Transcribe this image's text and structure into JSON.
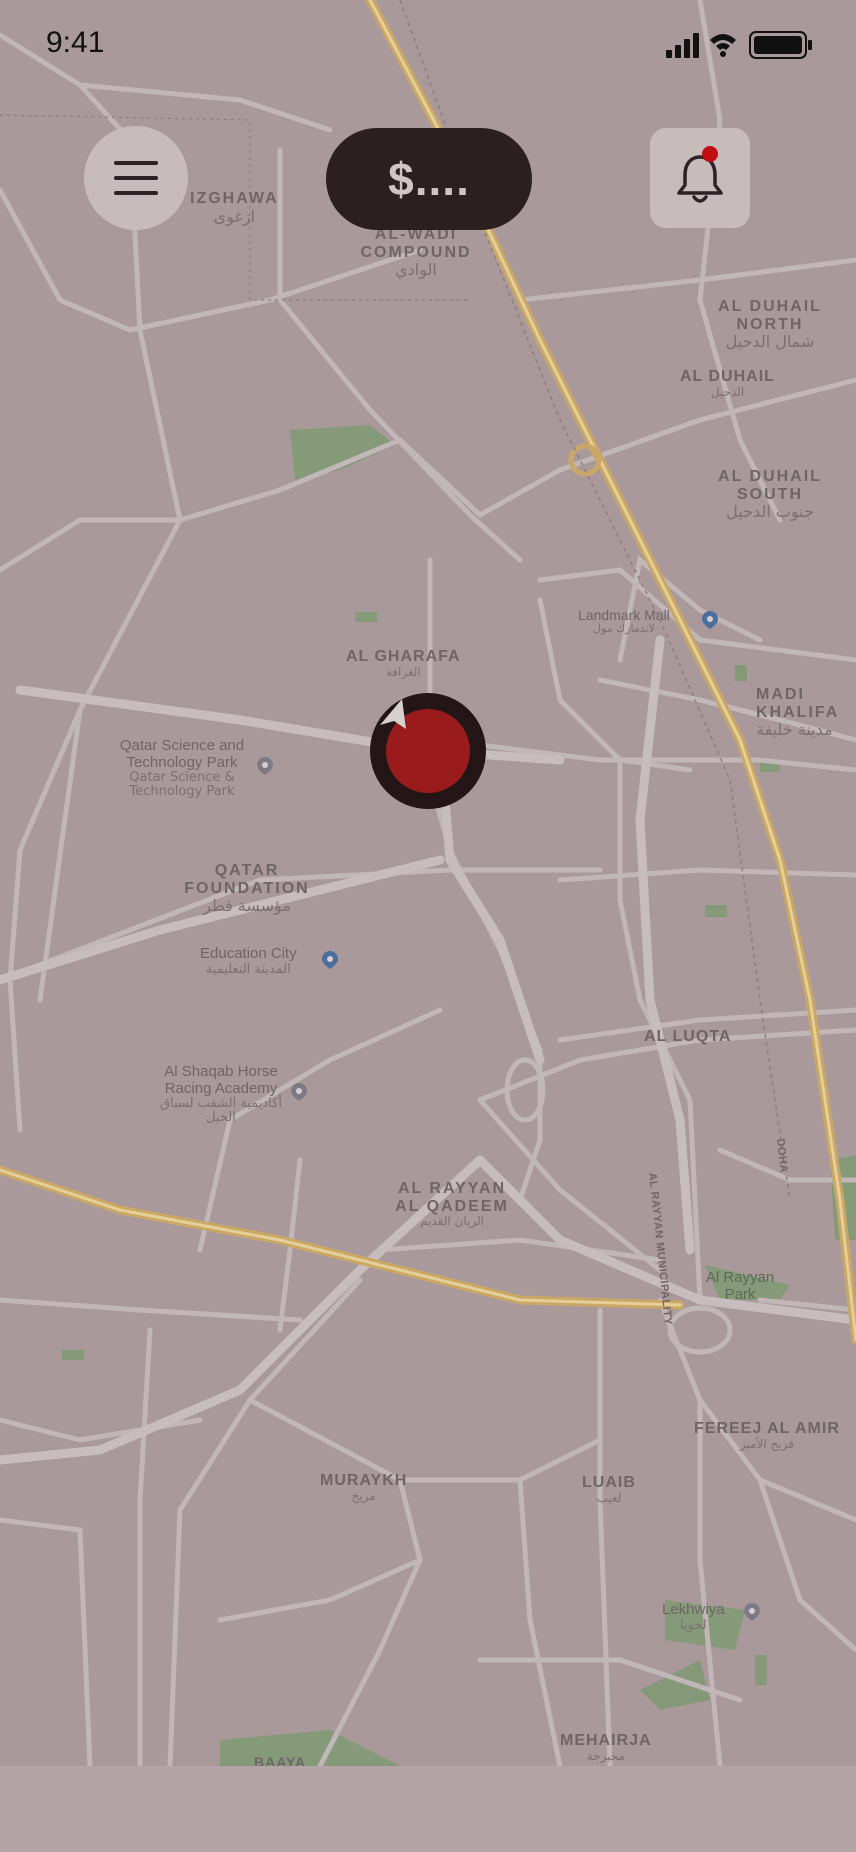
{
  "status_bar": {
    "time": "9:41"
  },
  "header": {
    "balance_label": "$...."
  },
  "icons": {
    "menu": "hamburger-menu-icon",
    "notifications": "bell-icon",
    "location": "navigation-arrow-icon"
  },
  "colors": {
    "pill_bg": "#2b1f20",
    "notification_dot": "#c00d14",
    "marker": "#9a1b1b",
    "map_bg": "#a9999b"
  },
  "map": {
    "areas": [
      {
        "en": "IZGHAWA",
        "ar": "ازغوى"
      },
      {
        "en": "AL-WADI COMPOUND",
        "ar": "الوادي"
      },
      {
        "en": "AL DUHAIL NORTH",
        "ar": "شمال الدحيل"
      },
      {
        "en": "AL DUHAIL",
        "ar": "الدحيل"
      },
      {
        "en": "AL DUHAIL SOUTH",
        "ar": "جنوب الدحيل"
      },
      {
        "en": "AL GHARAFA",
        "ar": "الغرافة"
      },
      {
        "en": "MADI KHALIFA",
        "ar": "مدينة خليفة"
      },
      {
        "en": "QATAR FOUNDATION",
        "ar": "مؤسسة قطر"
      },
      {
        "en": "AL LUQTA",
        "ar": ""
      },
      {
        "en": "AL RAYYAN AL QADEEM",
        "ar": "الريان القديم"
      },
      {
        "en": "FEREEJ AL AMIR",
        "ar": "فريج الأمير"
      },
      {
        "en": "MURAYKH",
        "ar": "مريخ"
      },
      {
        "en": "LUAIB",
        "ar": "لعيب"
      },
      {
        "en": "MEHAIRJA",
        "ar": "محيرجة"
      },
      {
        "en": "BAAYA",
        "ar": ""
      },
      {
        "en": "AL RAYYAN MUNICIPALITY",
        "ar": ""
      },
      {
        "en": "DOHA",
        "ar": ""
      }
    ],
    "pois": [
      {
        "en": "Landmark Mall",
        "ar": "لاندمارك مول"
      },
      {
        "en": "Qatar Science and Technology Park",
        "ar": "Qatar Science & Technology Park"
      },
      {
        "en": "Education City",
        "ar": "المدينة التعليمية"
      },
      {
        "en": "Al Shaqab Horse Racing Academy",
        "ar": "أكاديمية الشقب لسباق الخيل"
      },
      {
        "en": "Al Rayyan Park",
        "ar": ""
      },
      {
        "en": "Lekhwiya",
        "ar": "لخويا"
      }
    ]
  }
}
